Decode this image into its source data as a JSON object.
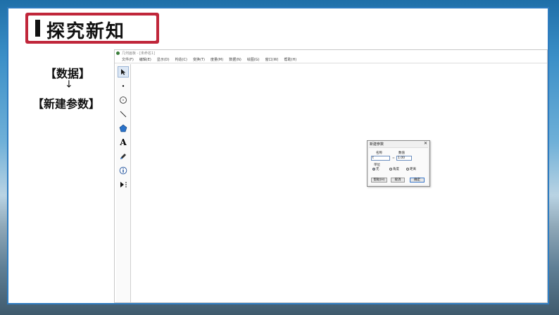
{
  "slide_title": "探究新知",
  "steps": [
    "【数据】",
    "【新建参数】"
  ],
  "step_arrow": "↓",
  "app": {
    "window_title": "几何画板 - [未命名1]",
    "menu": [
      "文件(F)",
      "编辑(E)",
      "显示(D)",
      "构造(C)",
      "变换(T)",
      "度量(M)",
      "数据(N)",
      "绘图(G)",
      "窗口(W)",
      "帮助(H)"
    ],
    "tools": [
      {
        "name": "arrow-select-icon"
      },
      {
        "name": "point-icon"
      },
      {
        "name": "compass-circle-icon"
      },
      {
        "name": "straightedge-line-icon"
      },
      {
        "name": "polygon-icon"
      },
      {
        "name": "text-tool-icon",
        "glyph": "A"
      },
      {
        "name": "marker-pen-icon"
      },
      {
        "name": "information-icon"
      },
      {
        "name": "custom-tool-icon"
      }
    ]
  },
  "dialog": {
    "title": "新建参数",
    "name_label": "名称",
    "value_label": "数值",
    "name_value": "t",
    "equals": "=",
    "value": "1.00",
    "unit_label": "单位",
    "units": [
      "无",
      "角度",
      "距离"
    ],
    "selected_unit": "无",
    "buttons": {
      "help": "帮助(H)",
      "cancel": "取消",
      "ok": "确定"
    }
  },
  "colors": {
    "title_frame": "#c0263a",
    "slide_border": "#2f7cc0"
  }
}
